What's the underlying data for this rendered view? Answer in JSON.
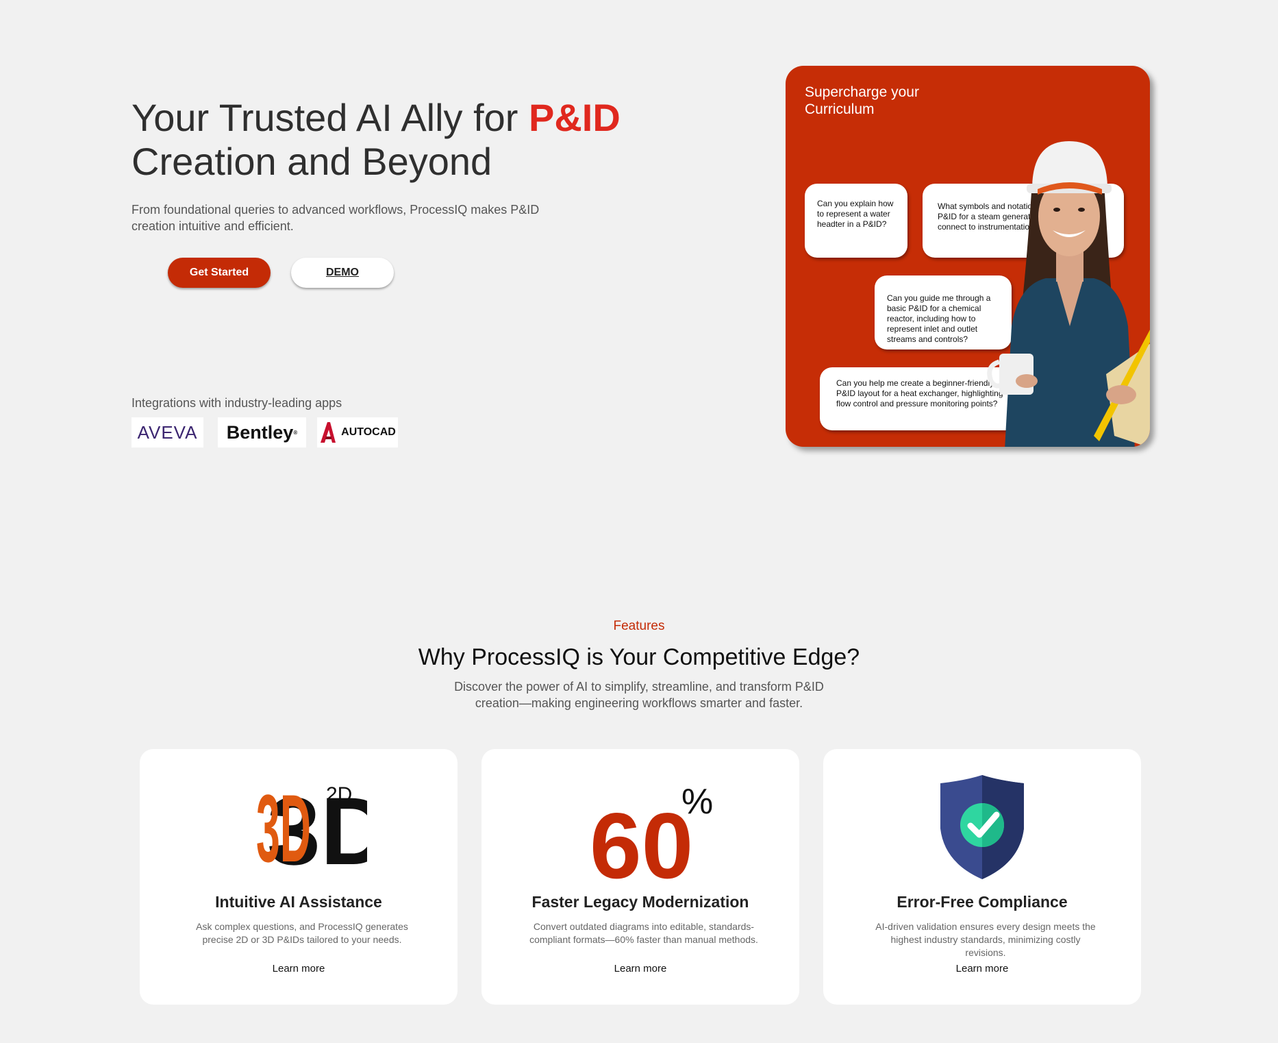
{
  "hero": {
    "title_part1": "Your Trusted AI Ally for ",
    "title_accent": "P&ID",
    "title_part2": "Creation and Beyond",
    "subtitle": "From foundational queries to advanced workflows, ProcessIQ makes P&ID creation intuitive and efficient.",
    "primary_button": "Get Started",
    "secondary_button": "DEMO",
    "integrations_label": "Integrations with industry-leading apps",
    "logos": [
      "AVEVA",
      "Bentley",
      "AUTOCAD"
    ]
  },
  "hero_card": {
    "heading": "Supercharge your Curriculum",
    "bubbles": [
      "Can you explain how to represent a water headter in a P&ID?",
      "What symbols and notations are used in a P&ID for a steam generator, and how do they connect to instrumentation?",
      "Can you guide me through a basic P&ID for a chemical reactor, including how to represent inlet and outlet streams and controls?",
      "Can you help me create a beginner-friendly P&ID layout for a heat exchanger, highlighting flow control and pressure monitoring points?"
    ]
  },
  "features": {
    "kicker": "Features",
    "title": "Why ProcessIQ is Your Competitive Edge?",
    "subtitle": "Discover the power of AI to simplify, streamline, and transform P&ID creation—making engineering workflows smarter and faster.",
    "cards": [
      {
        "icon": "3d-2d-icon",
        "icon_big": "3D",
        "icon_small": "2D",
        "title": "Intuitive AI Assistance",
        "text": "Ask complex questions, and ProcessIQ generates precise 2D or 3D P&IDs tailored to your needs.",
        "link": "Learn more"
      },
      {
        "icon": "percent-icon",
        "icon_big": "60",
        "icon_small": "%",
        "title": "Faster Legacy Modernization",
        "text": "Convert outdated diagrams into editable, standards-compliant formats—60% faster than manual methods.",
        "link": "Learn more"
      },
      {
        "icon": "shield-check-icon",
        "title": "Error-Free Compliance",
        "text": "AI-driven validation ensures every design meets the highest industry standards, minimizing costly revisions.",
        "link": "Learn more"
      }
    ]
  },
  "colors": {
    "accent": "#c42b06",
    "title_accent": "#e0281e",
    "background": "#f1f1f1"
  }
}
